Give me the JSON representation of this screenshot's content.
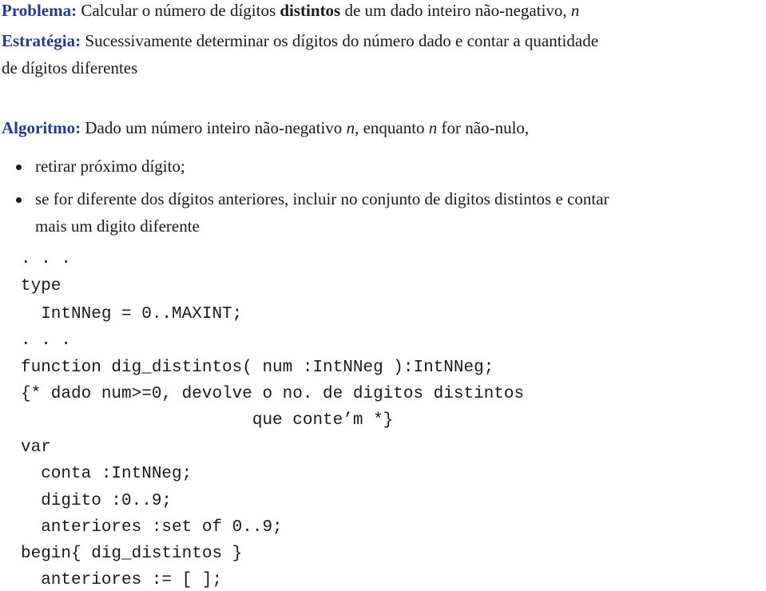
{
  "problem": {
    "label": "Problema:",
    "text_before": "Calcular o número de dígitos ",
    "text_bold": "distintos",
    "text_after": " de um dado inteiro não-negativo, ",
    "var": "n"
  },
  "strategy": {
    "label": "Estratégia:",
    "line1": "Sucessivamente determinar os dígitos do número dado e contar a quantidade",
    "line2": "de dígitos diferentes"
  },
  "algorithm": {
    "label": "Algoritmo:",
    "text1": "Dado um número inteiro não-negativo ",
    "var1": "n",
    "text2": ", enquanto ",
    "var2": "n",
    "text3": " for não-nulo,",
    "bullets": [
      {
        "line1": "retirar próximo dígito;"
      },
      {
        "line1": "se for diferente dos dígitos anteriores, incluir no conjunto de digitos distintos e contar",
        "line2": "mais um digito diferente"
      }
    ]
  },
  "code": {
    "lines": [
      ". . .",
      "type",
      "  IntNNeg = 0..MAXINT;",
      ". . .",
      "function dig_distintos( num :IntNNeg ):IntNNeg;",
      "{* dado num>=0, devolve o no. de digitos distintos",
      "                       que conte’m *}",
      "var",
      "  conta :IntNNeg;",
      "  digito :0..9;",
      "  anteriores :set of 0..9;",
      "begin{ dig_distintos }",
      "  anteriores := [ ];"
    ]
  },
  "colors": {
    "label": "#283a80",
    "text": "#1a1a1a"
  }
}
